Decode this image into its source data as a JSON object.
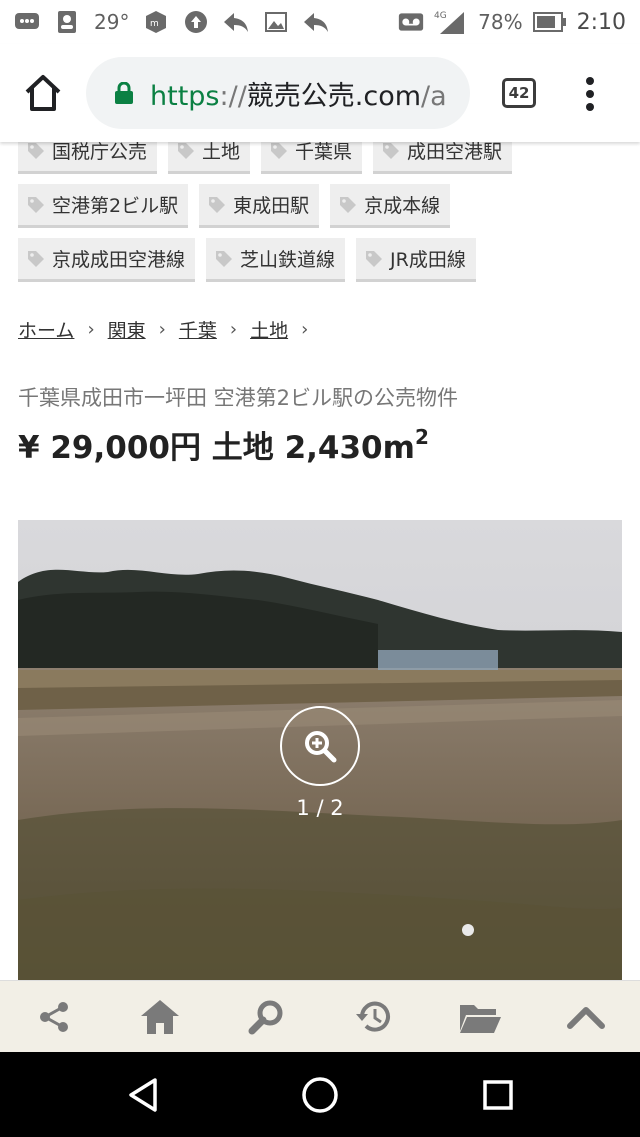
{
  "status_bar": {
    "temperature": "29°",
    "network": "4G",
    "battery": "78%",
    "time": "2:10"
  },
  "browser": {
    "url_scheme": "https",
    "url_sep": "://",
    "url_host": "競売公売.com",
    "url_rest": "/a",
    "tab_count": "42"
  },
  "tags": [
    [
      "国税庁公売",
      "土地",
      "千葉県",
      "成田空港駅"
    ],
    [
      "空港第2ビル駅",
      "東成田駅",
      "京成本線"
    ],
    [
      "京成成田空港線",
      "芝山鉄道線",
      "JR成田線"
    ]
  ],
  "breadcrumb": [
    "ホーム",
    "関東",
    "千葉",
    "土地"
  ],
  "listing": {
    "subtitle": "千葉県成田市一坪田 空港第2ビル駅の公売物件",
    "price": "¥ 29,000円 土地 2,430m",
    "area_exponent": "2",
    "photo_counter": "1 / 2"
  }
}
